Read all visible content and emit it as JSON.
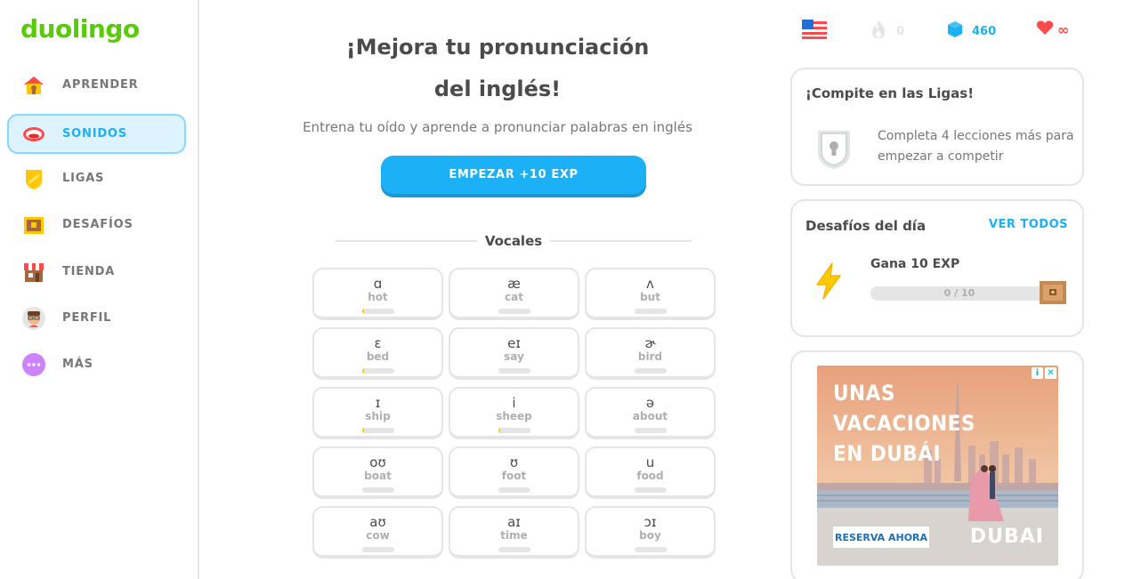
{
  "brand": {
    "logo": "duolingo",
    "color": "#58cc02"
  },
  "sidebar": {
    "items": [
      {
        "label": "APRENDER",
        "icon": "home-icon",
        "active": false
      },
      {
        "label": "SONIDOS",
        "icon": "mouth-icon",
        "active": true
      },
      {
        "label": "LIGAS",
        "icon": "shield-icon",
        "active": false
      },
      {
        "label": "DESAFÍOS",
        "icon": "treasure-chest-icon",
        "active": false
      },
      {
        "label": "TIENDA",
        "icon": "shop-icon",
        "active": false
      },
      {
        "label": "PERFIL",
        "icon": "avatar-icon",
        "active": false
      },
      {
        "label": "MÁS",
        "icon": "more-icon",
        "active": false
      }
    ]
  },
  "main": {
    "title": "¡Mejora tu pronunciación del inglés!",
    "subtitle": "Entrena tu oído y aprende a pronunciar palabras en inglés",
    "start_button": "EMPEZAR +10 EXP",
    "section_title": "Vocales",
    "sounds": [
      {
        "symbol": "ɑ",
        "word": "hot",
        "progress": 0.05
      },
      {
        "symbol": "æ",
        "word": "cat",
        "progress": 0
      },
      {
        "symbol": "ʌ",
        "word": "but",
        "progress": 0
      },
      {
        "symbol": "ɛ",
        "word": "bed",
        "progress": 0.05
      },
      {
        "symbol": "eɪ",
        "word": "say",
        "progress": 0
      },
      {
        "symbol": "ɚ",
        "word": "bird",
        "progress": 0
      },
      {
        "symbol": "ɪ",
        "word": "ship",
        "progress": 0.05
      },
      {
        "symbol": "i",
        "word": "sheep",
        "progress": 0.05
      },
      {
        "symbol": "ə",
        "word": "about",
        "progress": 0
      },
      {
        "symbol": "oʊ",
        "word": "boat",
        "progress": 0
      },
      {
        "symbol": "ʊ",
        "word": "foot",
        "progress": 0
      },
      {
        "symbol": "u",
        "word": "food",
        "progress": 0
      },
      {
        "symbol": "aʊ",
        "word": "cow",
        "progress": 0
      },
      {
        "symbol": "aɪ",
        "word": "time",
        "progress": 0
      },
      {
        "symbol": "ɔɪ",
        "word": "boy",
        "progress": 0
      }
    ]
  },
  "stats": {
    "language_flag": "us-flag-icon",
    "streak": "0",
    "gems": "460",
    "hearts": "∞",
    "colors": {
      "gems": "#1cb0f6",
      "hearts": "#ff4b4b",
      "streak": "#e5e5e5"
    }
  },
  "leagues": {
    "title": "¡Compite en las Ligas!",
    "text": "Completa 4 lecciones más para empezar a competir"
  },
  "quests": {
    "title": "Desafíos del día",
    "view_all": "VER TODOS",
    "quest_title": "Gana 10 EXP",
    "progress_text": "0 / 10",
    "progress": 0
  },
  "ad": {
    "headline_1": "UNAS",
    "headline_2": "VACACIONES",
    "headline_3": "EN DUBÁI",
    "cta": "RESERVA AHORA",
    "logo": "DUBAI"
  }
}
